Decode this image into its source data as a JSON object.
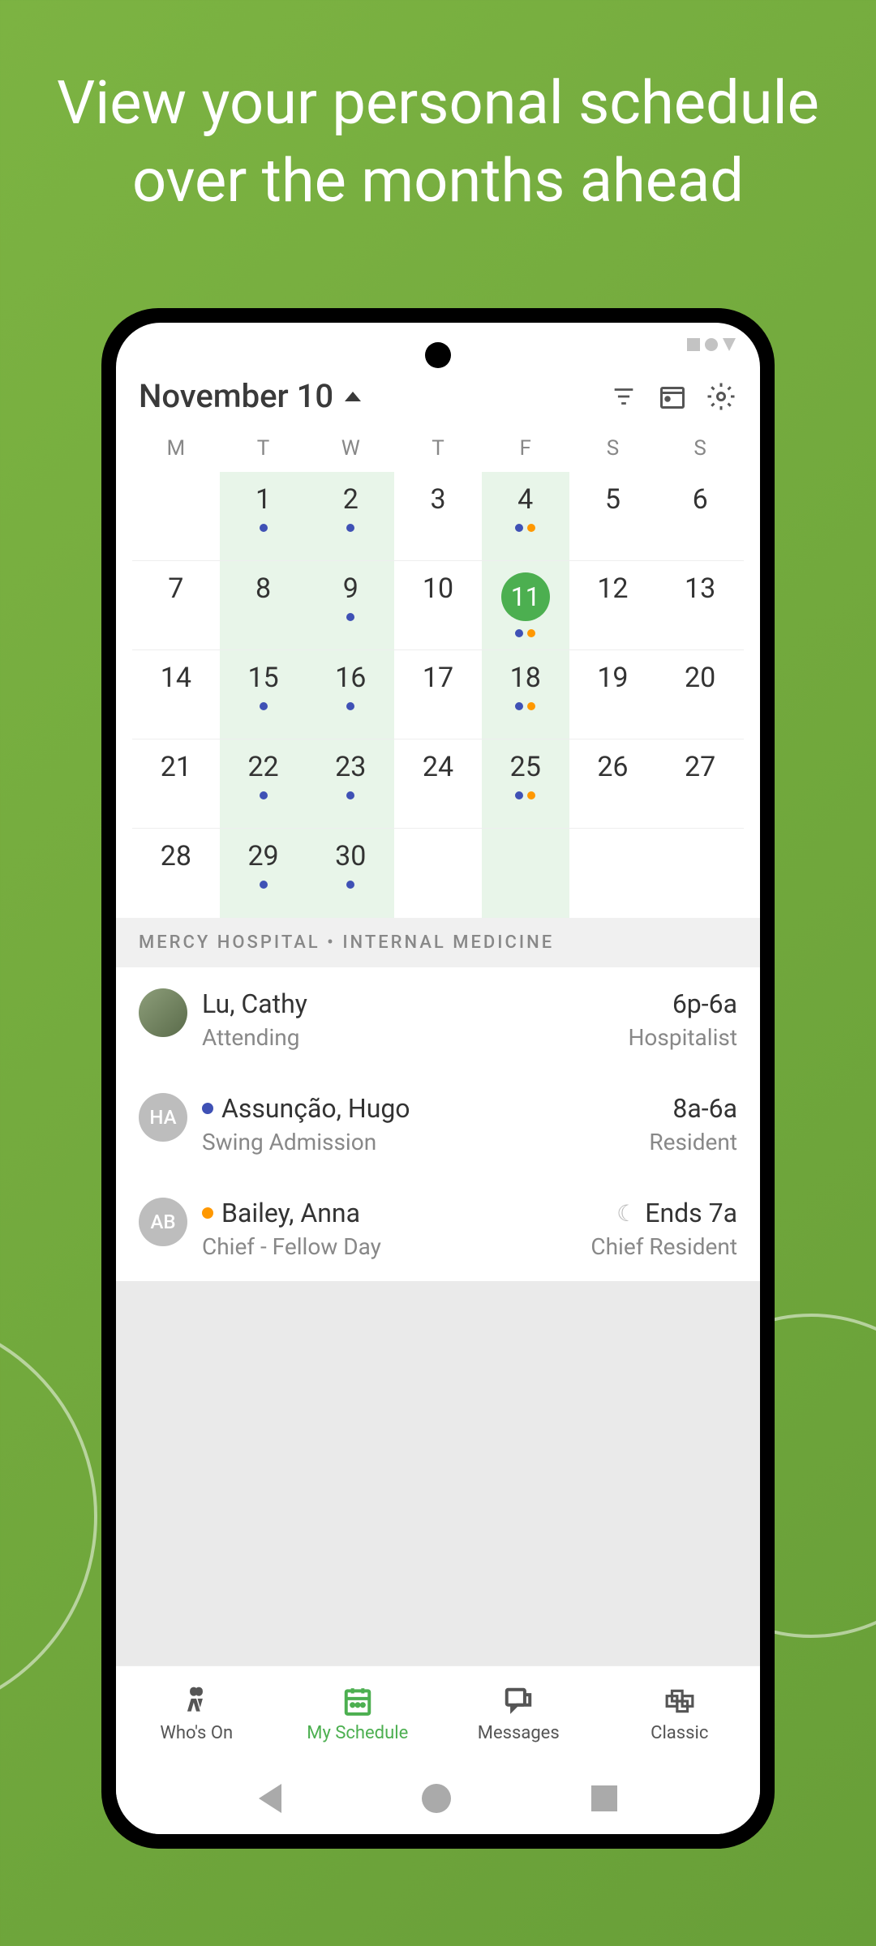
{
  "banner": "View your personal schedule over the months ahead",
  "header": {
    "title": "November 10"
  },
  "weekdays": [
    "M",
    "T",
    "W",
    "T",
    "F",
    "S",
    "S"
  ],
  "calendar": {
    "rows": [
      [
        {
          "n": ""
        },
        {
          "n": "1",
          "dots": [
            "blue"
          ]
        },
        {
          "n": "2",
          "dots": [
            "blue"
          ]
        },
        {
          "n": "3"
        },
        {
          "n": "4",
          "dots": [
            "blue",
            "orange"
          ]
        },
        {
          "n": "5"
        },
        {
          "n": "6"
        }
      ],
      [
        {
          "n": "7"
        },
        {
          "n": "8"
        },
        {
          "n": "9",
          "dots": [
            "blue"
          ]
        },
        {
          "n": "10"
        },
        {
          "n": "11",
          "selected": true,
          "dots": [
            "blue",
            "orange"
          ]
        },
        {
          "n": "12"
        },
        {
          "n": "13"
        }
      ],
      [
        {
          "n": "14"
        },
        {
          "n": "15",
          "dots": [
            "blue"
          ]
        },
        {
          "n": "16",
          "dots": [
            "blue"
          ]
        },
        {
          "n": "17"
        },
        {
          "n": "18",
          "dots": [
            "blue",
            "orange"
          ]
        },
        {
          "n": "19"
        },
        {
          "n": "20"
        }
      ],
      [
        {
          "n": "21"
        },
        {
          "n": "22",
          "dots": [
            "blue"
          ]
        },
        {
          "n": "23",
          "dots": [
            "blue"
          ]
        },
        {
          "n": "24"
        },
        {
          "n": "25",
          "dots": [
            "blue",
            "orange"
          ]
        },
        {
          "n": "26"
        },
        {
          "n": "27"
        }
      ],
      [
        {
          "n": "28"
        },
        {
          "n": "29",
          "dots": [
            "blue"
          ]
        },
        {
          "n": "30",
          "dots": [
            "blue"
          ]
        },
        {
          "n": ""
        },
        {
          "n": ""
        },
        {
          "n": ""
        },
        {
          "n": ""
        }
      ]
    ]
  },
  "context": "MERCY HOSPITAL • INTERNAL MEDICINE",
  "schedule": [
    {
      "initials": "",
      "photo": true,
      "name": "Lu, Cathy",
      "role": "Attending",
      "time": "6p-6a",
      "position": "Hospitalist",
      "color": ""
    },
    {
      "initials": "HA",
      "name": "Assunção, Hugo",
      "role": "Swing Admission",
      "time": "8a-6a",
      "position": "Resident",
      "color": "blue"
    },
    {
      "initials": "AB",
      "name": "Bailey, Anna",
      "role": "Chief - Fellow Day",
      "time": "Ends 7a",
      "position": "Chief Resident",
      "color": "orange",
      "moon": true
    }
  ],
  "nav": [
    {
      "label": "Who's On"
    },
    {
      "label": "My Schedule",
      "active": true
    },
    {
      "label": "Messages"
    },
    {
      "label": "Classic"
    }
  ]
}
